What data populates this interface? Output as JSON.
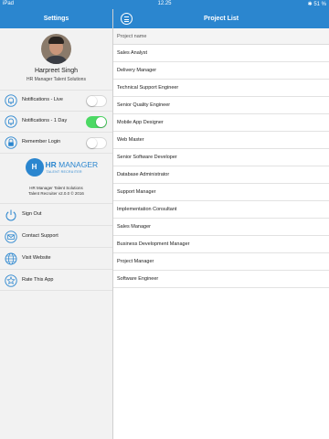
{
  "status_bar": {
    "device": "iPad",
    "time": "12.25",
    "bluetooth": "✱",
    "battery": "51 %"
  },
  "left_panel": {
    "header_title": "Settings",
    "user": {
      "name": "Harpreet Singh",
      "subtitle": "HR Manager Talent Solutions"
    },
    "settings": [
      {
        "label": "Notifications - Live",
        "icon": "bell-icon",
        "enabled": false
      },
      {
        "label": "Notifications - 1 Day",
        "icon": "bell-icon",
        "enabled": true
      },
      {
        "label": "Remember Login",
        "icon": "lock-icon",
        "enabled": false
      }
    ],
    "brand": {
      "logo_letter": "H",
      "logo_word1": "HR",
      "logo_word2": "MANAGER",
      "logo_sub": "TALENT RECRUITER",
      "line1": "HR Manager Talent Solutions",
      "line2": "Talent Recruiter v2.0.0 © 2016"
    },
    "menu": [
      {
        "label": "Sign Out",
        "icon": "power-icon"
      },
      {
        "label": "Contact Support",
        "icon": "mail-icon"
      },
      {
        "label": "Visit Website",
        "icon": "globe-icon"
      },
      {
        "label": "Rate This App",
        "icon": "star-icon"
      }
    ]
  },
  "right_panel": {
    "header_title": "Project List",
    "column_header": "Project name",
    "projects": [
      "Sales Analyst",
      "Delivery Manager",
      "Technical Support Engineer",
      "Senior Quality Engineer",
      "Mobile App Designer",
      "Web Master",
      "Senior Software Developer",
      "Database Administrator",
      "Support Manager",
      "Implementation Consultant",
      "Sales Manager",
      "Business Development Manager",
      "Project Manager",
      "Software Engineer"
    ]
  },
  "colors": {
    "accent": "#2b86cf",
    "toggle_on": "#4cd964",
    "pane_bg": "#f2f2f2"
  }
}
